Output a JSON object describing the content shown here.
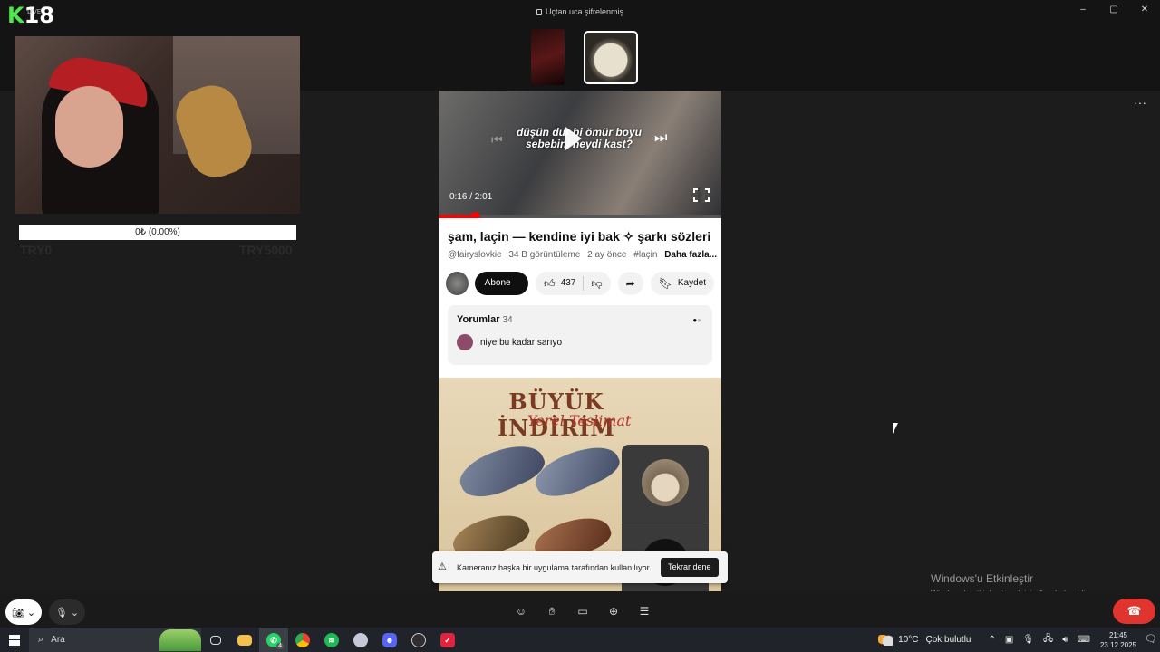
{
  "app": {
    "encryption_label": "Uçtan uca şifrelenmiş",
    "window_controls": [
      "–",
      "▢",
      "✕"
    ],
    "logo_k": "K",
    "logo_num": "18",
    "logo_small": "LIVE"
  },
  "stream_overlay": {
    "donation_text": "0₺ (0.00%)",
    "donation_progress": 0.0,
    "goal_min": "TRY0",
    "goal_max": "TRY5000"
  },
  "video": {
    "caption": "düşün dur bi ömür boyu sebebini neydi kast?",
    "time": "0:16 / 2:01",
    "progress": 0.132
  },
  "info": {
    "title": "şam, laçin — kendine iyi bak ✧ şarkı sözleri",
    "channel": "@fairyslovkie",
    "views": "34 B görüntüleme",
    "age": "2 ay önce",
    "hashtag": "#laçin",
    "more": "Daha fazla...",
    "subscribe": "Abone ol",
    "likes": "437",
    "save": "Kaydet"
  },
  "comments": {
    "header": "Yorumlar",
    "count": "34",
    "first": "niye bu kadar sarıyo"
  },
  "ad": {
    "title": "BÜYÜK İNDİRİM",
    "subtitle": "Yerel Teslimat"
  },
  "toast": {
    "message": "Kameranız başka bir uygulama tarafından kullanılıyor.",
    "retry": "Tekrar dene"
  },
  "watermark": {
    "line1": "Windows'u Etkinleştir",
    "line2": "Windows'u etkinleştirmek için Ayarlar'a gidin."
  },
  "taskbar": {
    "search_placeholder": "Ara",
    "whatsapp_badge": "4",
    "temperature": "10°C",
    "weather": "Çok bulutlu",
    "time": "21:45",
    "date": "23.12.2025"
  },
  "colors": {
    "accent_red": "#e0342e",
    "progress_red": "#ff0000",
    "logo_green": "#4ee84a"
  }
}
